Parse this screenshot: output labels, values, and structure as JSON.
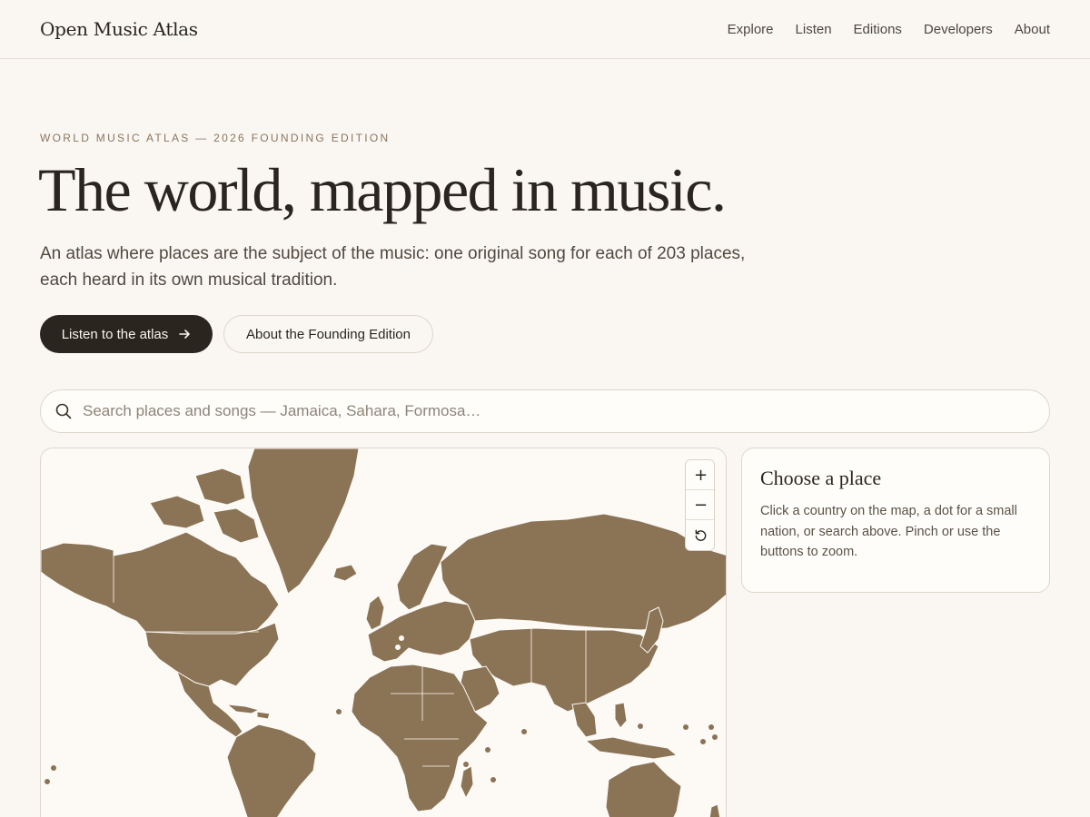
{
  "header": {
    "brand": "Open Music Atlas",
    "nav": [
      {
        "label": "Explore"
      },
      {
        "label": "Listen"
      },
      {
        "label": "Editions"
      },
      {
        "label": "Developers"
      },
      {
        "label": "About"
      }
    ]
  },
  "hero": {
    "eyebrow": "WORLD MUSIC ATLAS — 2026 FOUNDING EDITION",
    "title": "The world, mapped in music.",
    "lede": "An atlas where places are the subject of the music: one original song for each of 203 places, each heard in its own musical tradition.",
    "primary_label": "Listen to the atlas",
    "primary_icon": "arrow-right-icon",
    "secondary_label": "About the Founding Edition"
  },
  "search": {
    "placeholder": "Search places and songs — Jamaica, Sahara, Formosa…",
    "value": "",
    "icon": "search-icon"
  },
  "map": {
    "land_color": "#8b7355",
    "background_color": "#fdfaf6",
    "controls": [
      {
        "name": "zoom-in",
        "glyph": "+"
      },
      {
        "name": "zoom-out",
        "glyph": "−"
      },
      {
        "name": "reset-view",
        "icon": "reset-icon"
      }
    ]
  },
  "panel": {
    "title": "Choose a place",
    "body": "Click a country on the map, a dot for a small nation, or search above. Pinch or use the buttons to zoom."
  }
}
